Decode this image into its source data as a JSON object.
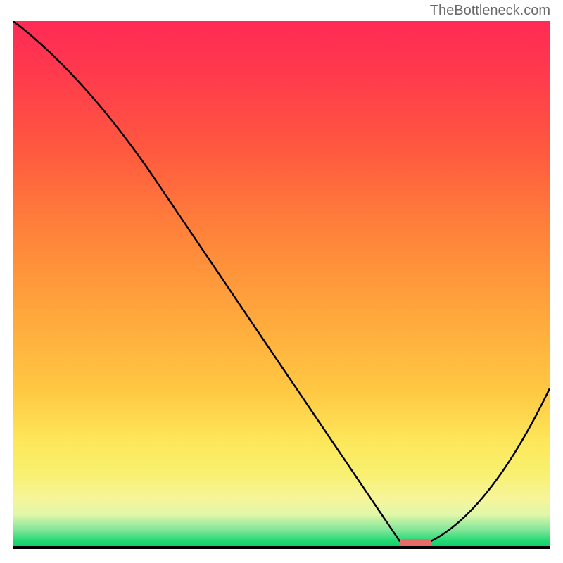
{
  "attribution": "TheBottleneck.com",
  "chart_data": {
    "type": "line",
    "title": "",
    "xlabel": "",
    "ylabel": "",
    "xlim": [
      0,
      100
    ],
    "ylim": [
      0,
      100
    ],
    "x": [
      0,
      25,
      72,
      78,
      100
    ],
    "values": [
      100,
      72,
      1,
      1,
      30
    ],
    "trough_range_x": [
      72,
      78
    ],
    "notes": "No numeric axes visible; values are relative positions read from pixel geometry. Curve descends from top-left, bends ~25% across, bottoms out at ~x=72–78 near y=0, then rises to ~y=30 at the right edge."
  },
  "colors": {
    "gradient_top": "#ff2a55",
    "gradient_mid": "#ffa53c",
    "gradient_low": "#fde75a",
    "gradient_bottom": "#11d06a",
    "curve": "#000000",
    "trough_mark": "#e86b6b",
    "attribution_text": "#6a6a6a"
  }
}
